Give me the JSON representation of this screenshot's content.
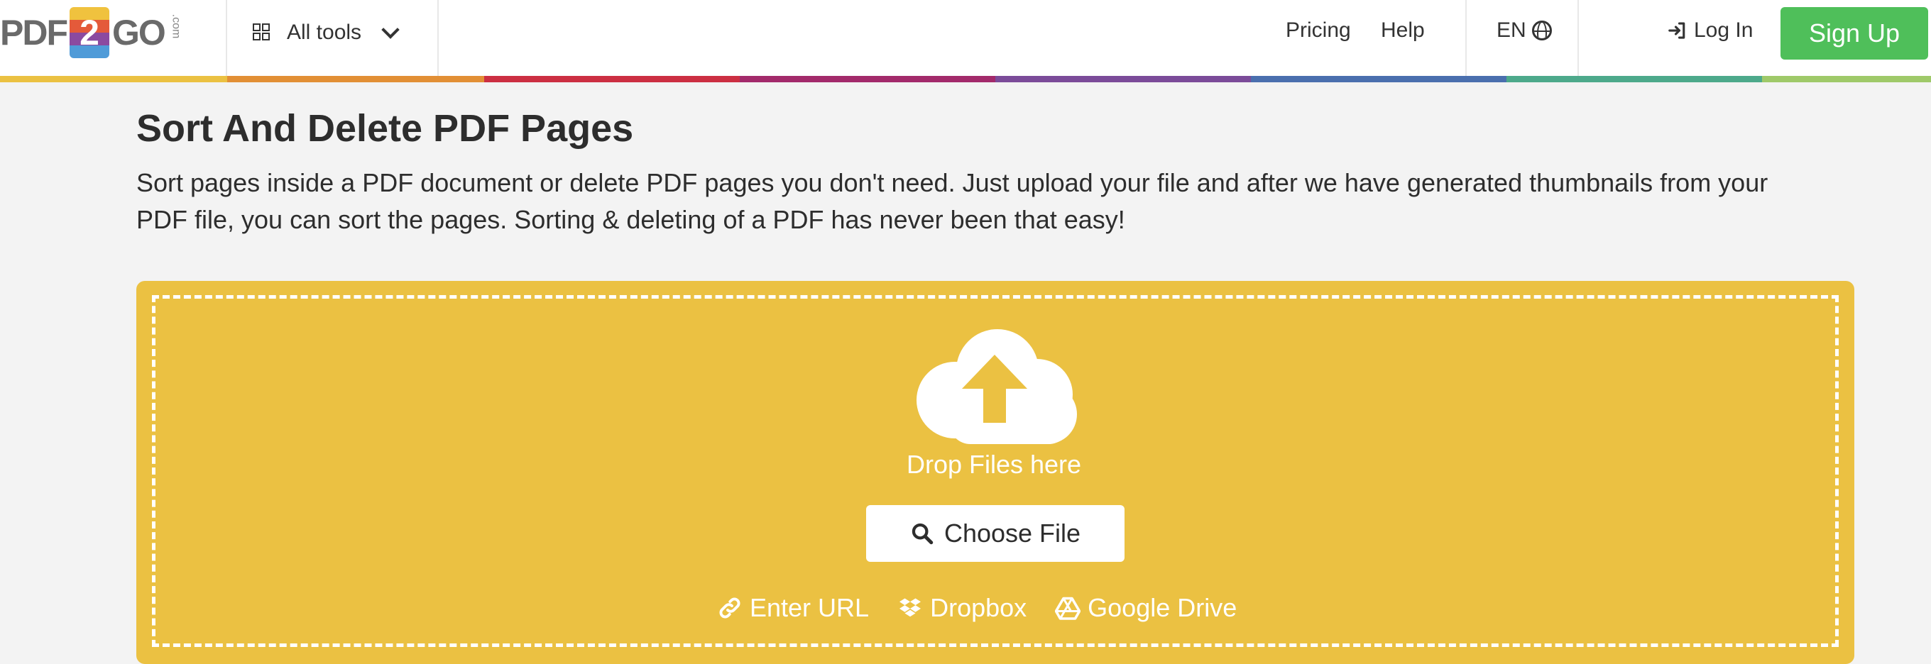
{
  "header": {
    "logo": {
      "left": "PDF",
      "num": "2",
      "right": "GO",
      "com": ".com"
    },
    "all_tools_label": "All tools",
    "nav": {
      "pricing": "Pricing",
      "help": "Help"
    },
    "language": "EN",
    "login": "Log In",
    "signup": "Sign Up"
  },
  "rainbow_colors": [
    "#ebc142",
    "#e28f35",
    "#cc2f42",
    "#a32a6b",
    "#7b4b99",
    "#4a6fae",
    "#4da98b",
    "#9fc969"
  ],
  "page": {
    "title": "Sort And Delete PDF Pages",
    "description": "Sort pages inside a PDF document or delete PDF pages you don't need. Just upload your file and after we have generated thumbnails from your PDF file, you can sort the pages. Sorting & deleting of a PDF has never been that easy!"
  },
  "upload": {
    "drop_label": "Drop Files here",
    "choose_label": "Choose File",
    "sources": [
      "Enter URL",
      "Dropbox",
      "Google Drive"
    ]
  },
  "colors": {
    "dropzone": "#ebc142",
    "signup": "#4fbf5a"
  },
  "icons": {
    "cloud": "cloud-upload-icon",
    "search": "search-icon",
    "link": "link-icon",
    "dropbox": "dropbox-icon",
    "drive": "google-drive-icon",
    "globe": "globe-icon",
    "login": "sign-in-icon",
    "grid": "grid-icon",
    "chevron": "chevron-down-icon"
  }
}
